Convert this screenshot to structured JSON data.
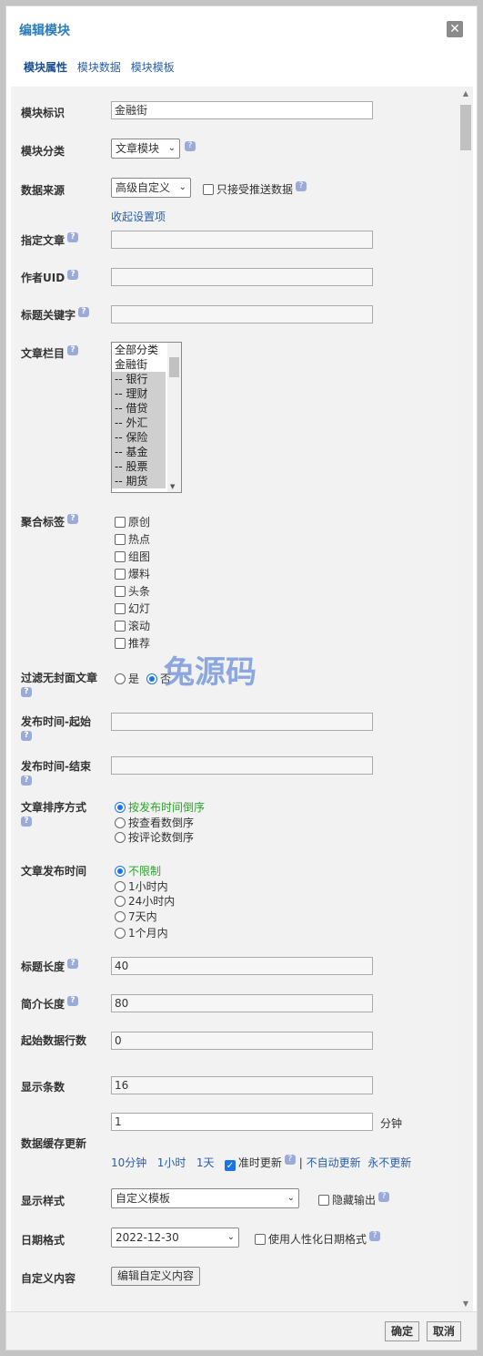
{
  "dialog": {
    "title": "编辑模块",
    "close": "✕"
  },
  "tabs": [
    "模块属性",
    "模块数据",
    "模块模板"
  ],
  "help_glyph": "?",
  "fields": {
    "module_id": {
      "label": "模块标识",
      "value": "金融街"
    },
    "module_cat": {
      "label": "模块分类",
      "value": "文章模块"
    },
    "data_source": {
      "label": "数据来源",
      "value": "高级自定义",
      "push_only": "只接受推送数据",
      "collapse": "收起设置项"
    },
    "article": {
      "label": "指定文章"
    },
    "author_uid": {
      "label": "作者UID"
    },
    "title_kw": {
      "label": "标题关键字"
    },
    "column": {
      "label": "文章栏目",
      "items": [
        "全部分类",
        "金融街",
        "-- 银行",
        "-- 理财",
        "-- 借贷",
        "-- 外汇",
        "-- 保险",
        "-- 基金",
        "-- 股票",
        "-- 期货"
      ]
    },
    "tags": {
      "label": "聚合标签",
      "items": [
        "原创",
        "热点",
        "组图",
        "爆料",
        "头条",
        "幻灯",
        "滚动",
        "推荐"
      ]
    },
    "filter_cover": {
      "label": "过滤无封面文章",
      "yes": "是",
      "no": "否"
    },
    "pub_start": {
      "label": "发布时间-起始"
    },
    "pub_end": {
      "label": "发布时间-结束"
    },
    "sort": {
      "label": "文章排序方式",
      "options": [
        "按发布时间倒序",
        "按查看数倒序",
        "按评论数倒序"
      ]
    },
    "pub_time": {
      "label": "文章发布时间",
      "options": [
        "不限制",
        "1小时内",
        "24小时内",
        "7天内",
        "1个月内"
      ]
    },
    "title_len": {
      "label": "标题长度",
      "value": "40"
    },
    "summary_len": {
      "label": "简介长度",
      "value": "80"
    },
    "start_row": {
      "label": "起始数据行数",
      "value": "0"
    },
    "show_count": {
      "label": "显示条数",
      "value": "16"
    },
    "cache": {
      "label": "数据缓存更新",
      "value": "1",
      "unit": "分钟",
      "l10": "10分钟",
      "l1h": "1小时",
      "l1d": "1天",
      "ontime": "准时更新",
      "sep": "|",
      "noauto": "不自动更新",
      "never": "永不更新"
    },
    "display": {
      "label": "显示样式",
      "value": "自定义模板",
      "hide": "隐藏输出"
    },
    "date_fmt": {
      "label": "日期格式",
      "value": "2022-12-30",
      "human": "使用人性化日期格式"
    },
    "custom": {
      "label": "自定义内容",
      "button": "编辑自定义内容"
    }
  },
  "footer": {
    "ok": "确定",
    "cancel": "取消"
  },
  "watermark": "兔源码"
}
